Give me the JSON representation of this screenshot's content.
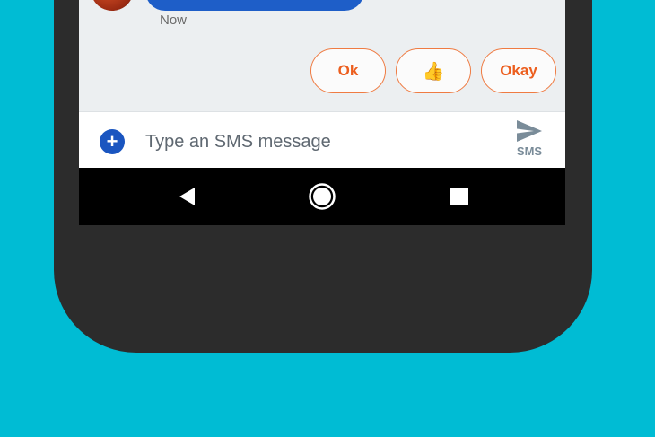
{
  "conversation": {
    "last_message_time": "Now"
  },
  "smart_replies": [
    {
      "label": "Ok"
    },
    {
      "label": "👍"
    },
    {
      "label": "Okay"
    }
  ],
  "composer": {
    "placeholder": "Type an SMS message",
    "send_label": "SMS"
  },
  "icons": {
    "add": "plus-circle-icon",
    "send": "send-icon",
    "back": "back-triangle-icon",
    "home": "home-circle-icon",
    "recents": "recents-square-icon"
  },
  "colors": {
    "background": "#00bcd4",
    "accent": "#1a55c0",
    "chip_border": "#ef7b42",
    "chip_text": "#ec5e1e"
  }
}
